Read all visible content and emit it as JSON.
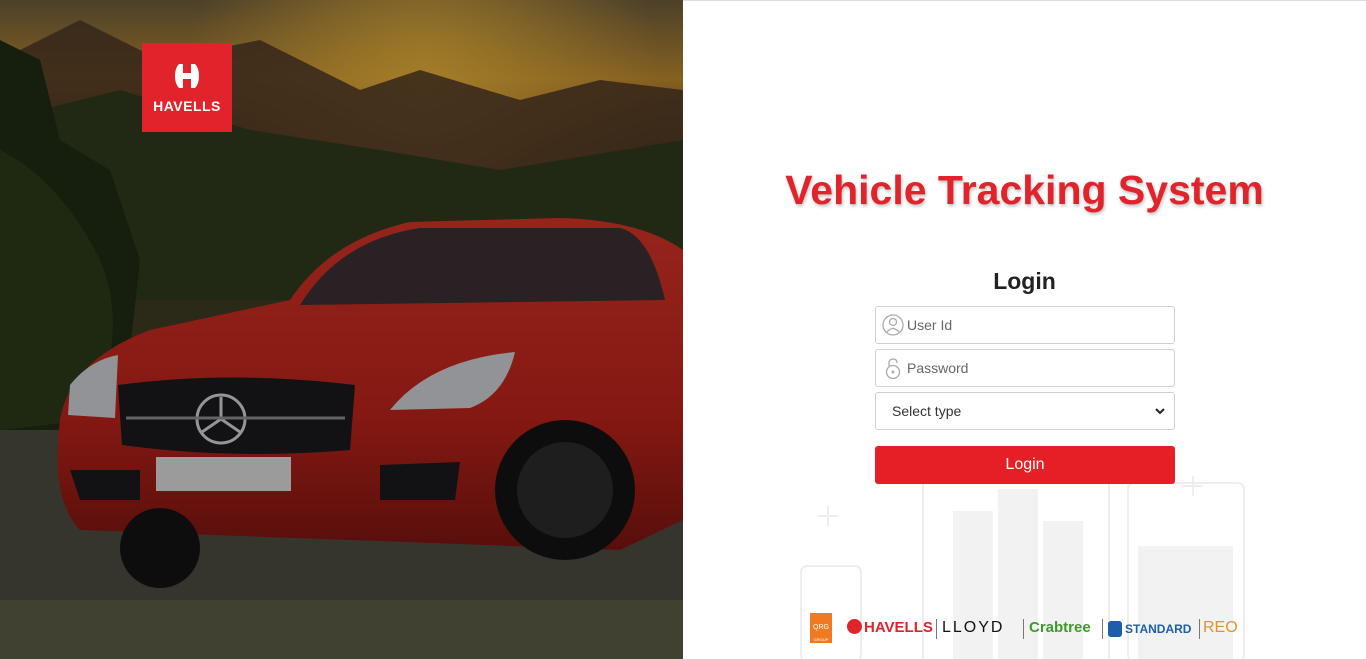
{
  "brand_logo": {
    "text": "HAVELLS",
    "color": "#e1242b"
  },
  "app": {
    "title": "Vehicle Tracking System"
  },
  "login": {
    "heading": "Login",
    "user_id_placeholder": "User Id",
    "password_placeholder": "Password",
    "type_select": {
      "selected": "Select type"
    },
    "button_label": "Login",
    "accent_color": "#e61f26"
  },
  "footer_brands": {
    "qrg": "QRG",
    "qrg_sub": "GROUP",
    "havells": "HAVELLS",
    "lloyd": "LLOYD",
    "crabtree": "Crabtree",
    "standard": "STANDARD",
    "reo": "REO"
  },
  "icons": [
    "user-icon",
    "lock-icon",
    "chevron-down-icon",
    "havells-logo-icon"
  ]
}
